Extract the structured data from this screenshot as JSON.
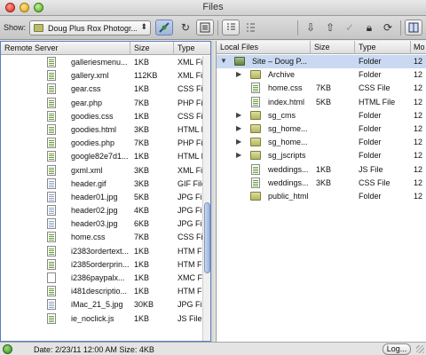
{
  "window": {
    "title": "Files"
  },
  "toolbar": {
    "show_label": "Show:",
    "site_value": "Doug Plus Rox Photogr...",
    "icons": [
      "connect-icon",
      "refresh-icon",
      "view-options-icon",
      "expand-icon",
      "collapse-icon",
      "get-icon",
      "put-icon",
      "check-out-icon",
      "check-in-icon",
      "synchronize-icon",
      "expand-panel-icon"
    ]
  },
  "remote": {
    "headers": {
      "name": "Remote Server",
      "size": "Size",
      "type": "Type"
    },
    "rows": [
      {
        "name": "galleriesmenu...",
        "size": "1KB",
        "type": "XML File",
        "icon": "xml-file-icon"
      },
      {
        "name": "gallery.xml",
        "size": "112KB",
        "type": "XML File",
        "icon": "xml-file-icon"
      },
      {
        "name": "gear.css",
        "size": "1KB",
        "type": "CSS File",
        "icon": "css-file-icon"
      },
      {
        "name": "gear.php",
        "size": "7KB",
        "type": "PHP File",
        "icon": "php-file-icon"
      },
      {
        "name": "goodies.css",
        "size": "1KB",
        "type": "CSS File",
        "icon": "css-file-icon"
      },
      {
        "name": "goodies.html",
        "size": "3KB",
        "type": "HTML File",
        "icon": "html-file-icon"
      },
      {
        "name": "goodies.php",
        "size": "7KB",
        "type": "PHP File",
        "icon": "php-file-icon"
      },
      {
        "name": "google82e7d1...",
        "size": "1KB",
        "type": "HTML File",
        "icon": "html-file-icon"
      },
      {
        "name": "gxml.xml",
        "size": "3KB",
        "type": "XML File",
        "icon": "xml-file-icon"
      },
      {
        "name": "header.gif",
        "size": "3KB",
        "type": "GIF File",
        "icon": "gif-file-icon"
      },
      {
        "name": "header01.jpg",
        "size": "5KB",
        "type": "JPG File",
        "icon": "jpg-file-icon"
      },
      {
        "name": "header02.jpg",
        "size": "4KB",
        "type": "JPG File",
        "icon": "jpg-file-icon"
      },
      {
        "name": "header03.jpg",
        "size": "6KB",
        "type": "JPG File",
        "icon": "jpg-file-icon"
      },
      {
        "name": "home.css",
        "size": "7KB",
        "type": "CSS File",
        "icon": "css-file-icon"
      },
      {
        "name": "i2383ordertext...",
        "size": "1KB",
        "type": "HTM File",
        "icon": "htm-file-icon"
      },
      {
        "name": "i2385orderprin...",
        "size": "1KB",
        "type": "HTM File",
        "icon": "htm-file-icon"
      },
      {
        "name": "i2386paypalx...",
        "size": "1KB",
        "type": "XMC File",
        "icon": "blank-file-icon"
      },
      {
        "name": "i481descriptio...",
        "size": "1KB",
        "type": "HTM File",
        "icon": "htm-file-icon"
      },
      {
        "name": "iMac_21_5.jpg",
        "size": "30KB",
        "type": "JPG File",
        "icon": "jpg-file-icon"
      },
      {
        "name": "ie_noclick.js",
        "size": "1KB",
        "type": "JS File",
        "icon": "js-file-icon"
      }
    ]
  },
  "local": {
    "headers": {
      "name": "Local Files",
      "size": "Size",
      "type": "Type",
      "modified": "Mo"
    },
    "rows": [
      {
        "name": "Site – Doug P...",
        "size": "",
        "type": "Folder",
        "modified": "12",
        "kind": "site",
        "level": 0,
        "toggle": "open",
        "selected": true
      },
      {
        "name": "Archive",
        "size": "",
        "type": "Folder",
        "modified": "12",
        "kind": "folder",
        "level": 1,
        "toggle": "closed"
      },
      {
        "name": "home.css",
        "size": "7KB",
        "type": "CSS File",
        "modified": "12",
        "kind": "file",
        "level": 1,
        "toggle": ""
      },
      {
        "name": "index.html",
        "size": "5KB",
        "type": "HTML File",
        "modified": "12",
        "kind": "file",
        "level": 1,
        "toggle": ""
      },
      {
        "name": "sg_cms",
        "size": "",
        "type": "Folder",
        "modified": "12",
        "kind": "folder",
        "level": 1,
        "toggle": "closed"
      },
      {
        "name": "sg_home...",
        "size": "",
        "type": "Folder",
        "modified": "12",
        "kind": "folder",
        "level": 1,
        "toggle": "closed"
      },
      {
        "name": "sg_home...",
        "size": "",
        "type": "Folder",
        "modified": "12",
        "kind": "folder",
        "level": 1,
        "toggle": "closed"
      },
      {
        "name": "sg_jscripts",
        "size": "",
        "type": "Folder",
        "modified": "12",
        "kind": "folder",
        "level": 1,
        "toggle": "closed"
      },
      {
        "name": "weddings...",
        "size": "1KB",
        "type": "JS File",
        "modified": "12",
        "kind": "file",
        "level": 1,
        "toggle": ""
      },
      {
        "name": "weddings...",
        "size": "3KB",
        "type": "CSS File",
        "modified": "12",
        "kind": "file",
        "level": 1,
        "toggle": ""
      },
      {
        "name": "public_html",
        "size": "",
        "type": "Folder",
        "modified": "12",
        "kind": "folder",
        "level": 1,
        "toggle": ""
      }
    ]
  },
  "status": {
    "text": "Date: 2/23/11 12:00 AM  Size: 4KB",
    "log_label": "Log..."
  }
}
